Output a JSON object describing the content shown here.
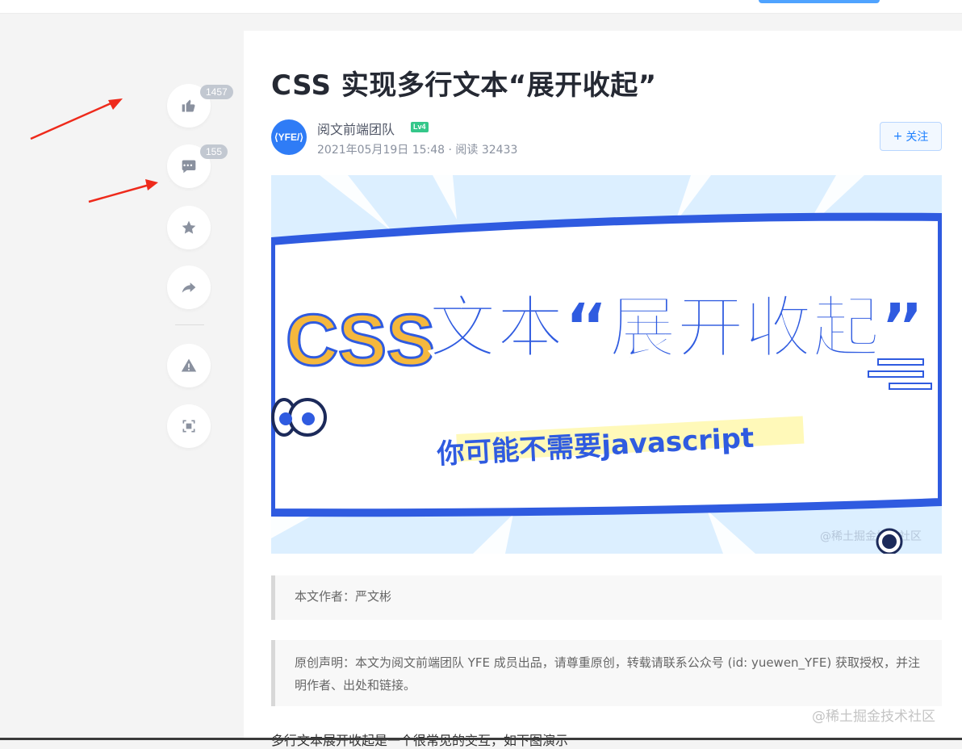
{
  "rail": {
    "like_count": "1457",
    "comment_count": "155",
    "icons": [
      "thumbs-up-icon",
      "comment-icon",
      "star-icon",
      "share-icon",
      "warning-icon",
      "focus-icon"
    ]
  },
  "article": {
    "title": "CSS 实现多行文本“展开收起”",
    "author": {
      "name": "阅文前端团队",
      "avatar_text": "⟨YFE/⟩",
      "level": "Lv4",
      "meta": "2021年05月19日 15:48 · 阅读 32433"
    },
    "follow_label": "关注",
    "cover": {
      "headline_left": "CSS",
      "headline_right": "文本“展开收起”",
      "subline": "你可能不需要javascript",
      "watermark": "@稀土掘金技术社区"
    },
    "quote_author": "本文作者：严文彬",
    "quote_statement": "原创声明：本文为阅文前端团队 YFE 成员出品，请尊重原创，转载请联系公众号 (id: yuewen_YFE) 获取授权，并注明作者、出处和链接。",
    "body_first_line": "多行文本展开收起是一个很常见的交互，如下图演示"
  },
  "page_watermark": "@稀土掘金技术社区",
  "colors": {
    "accent": "#1e80ff",
    "level_badge": "#35c78a",
    "annotation_arrow": "#ee2a1b",
    "cover_blue": "#2f5be0",
    "cover_orange": "#f5b83d"
  }
}
